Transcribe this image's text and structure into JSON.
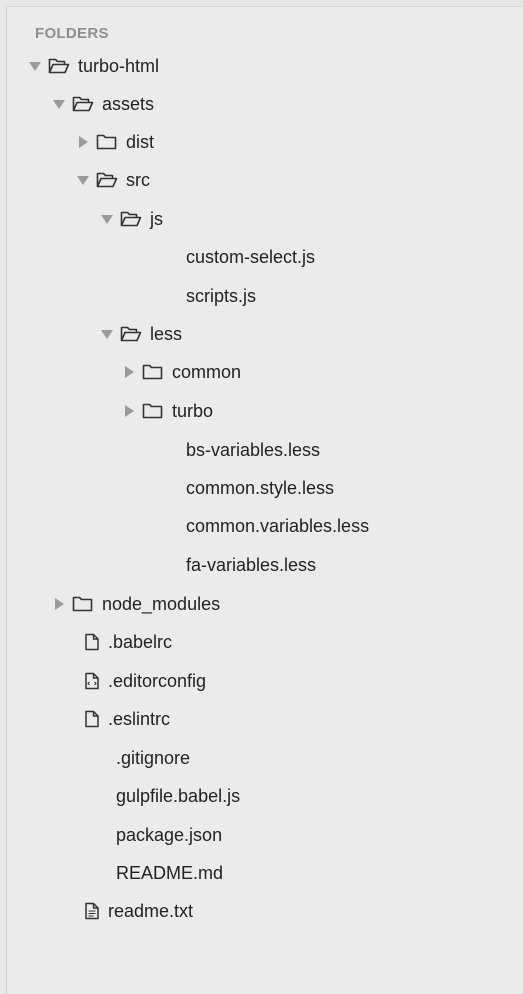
{
  "sidebar": {
    "header": "FOLDERS",
    "root": {
      "label": "turbo-html",
      "assets": {
        "label": "assets",
        "dist": "dist",
        "src": {
          "label": "src",
          "js": {
            "label": "js",
            "files": [
              "custom-select.js",
              "scripts.js"
            ]
          },
          "less": {
            "label": "less",
            "common": "common",
            "turbo": "turbo",
            "files": [
              "bs-variables.less",
              "common.style.less",
              "common.variables.less",
              "fa-variables.less"
            ]
          }
        }
      },
      "node_modules": "node_modules",
      "files": [
        ".babelrc",
        ".editorconfig",
        ".eslintrc",
        ".gitignore",
        "gulpfile.babel.js",
        "package.json",
        "README.md",
        "readme.txt"
      ]
    }
  },
  "icons": {
    "open_folder": "folder-open-icon",
    "closed_folder": "folder-icon",
    "file": "file-icon",
    "config_file": "config-file-icon",
    "text_file": "text-file-icon",
    "expanded": "triangle-down-icon",
    "collapsed": "triangle-right-icon"
  },
  "colors": {
    "background": "#ebebeb",
    "header_text": "#8e8e8e",
    "item_text": "#222222",
    "disclosure": "#9a9a9a"
  }
}
